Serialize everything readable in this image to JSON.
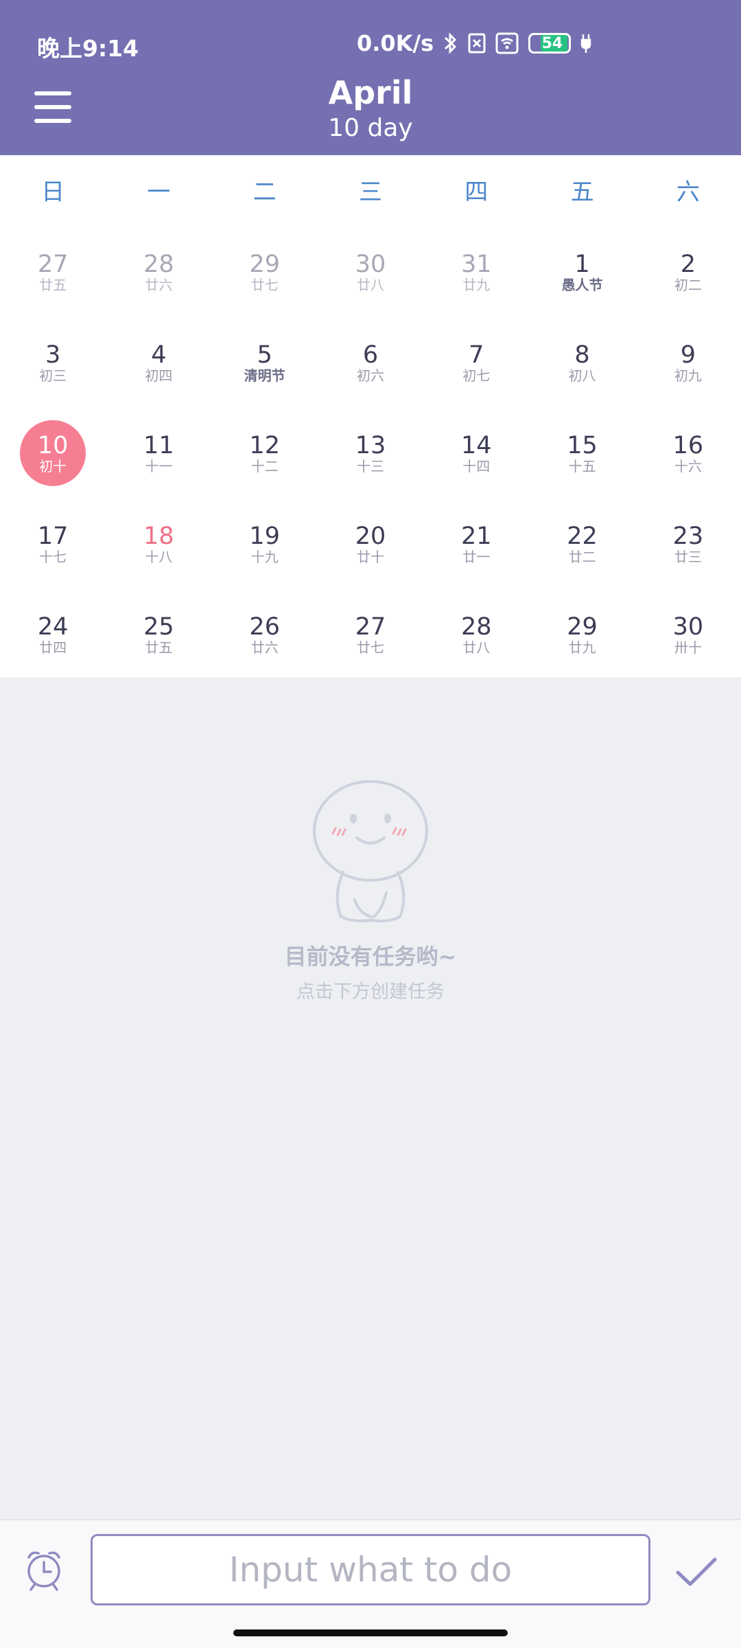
{
  "status_bar": {
    "time": "晚上9:14",
    "network_speed": "0.0K/s",
    "battery_level": "54",
    "icons": [
      "bluetooth-icon",
      "sim-off-icon",
      "wifi-icon",
      "battery-icon",
      "charging-icon"
    ]
  },
  "header": {
    "month": "April",
    "day_label": "10 day",
    "menu_icon": "menu-icon"
  },
  "colors": {
    "header_bg": "#7570b1",
    "weekday_text": "#4a86c9",
    "today_circle": "#f67e92",
    "holiday_text": "#f06f86",
    "page_bg": "#eeeff3"
  },
  "weekdays": [
    "日",
    "一",
    "二",
    "三",
    "四",
    "五",
    "六"
  ],
  "days": [
    {
      "num": "27",
      "lunar": "廿五"
    },
    {
      "num": "28",
      "lunar": "廿六"
    },
    {
      "num": "29",
      "lunar": "廿七"
    },
    {
      "num": "30",
      "lunar": "廿八"
    },
    {
      "num": "31",
      "lunar": "廿九"
    },
    {
      "num": "1",
      "lunar": "愚人节"
    },
    {
      "num": "2",
      "lunar": "初二"
    },
    {
      "num": "3",
      "lunar": "初三"
    },
    {
      "num": "4",
      "lunar": "初四"
    },
    {
      "num": "5",
      "lunar": "清明节"
    },
    {
      "num": "6",
      "lunar": "初六"
    },
    {
      "num": "7",
      "lunar": "初七"
    },
    {
      "num": "8",
      "lunar": "初八"
    },
    {
      "num": "9",
      "lunar": "初九"
    },
    {
      "num": "10",
      "lunar": "初十"
    },
    {
      "num": "11",
      "lunar": "十一"
    },
    {
      "num": "12",
      "lunar": "十二"
    },
    {
      "num": "13",
      "lunar": "十三"
    },
    {
      "num": "14",
      "lunar": "十四"
    },
    {
      "num": "15",
      "lunar": "十五"
    },
    {
      "num": "16",
      "lunar": "十六"
    },
    {
      "num": "17",
      "lunar": "十七"
    },
    {
      "num": "18",
      "lunar": "十八"
    },
    {
      "num": "19",
      "lunar": "十九"
    },
    {
      "num": "20",
      "lunar": "廿十"
    },
    {
      "num": "21",
      "lunar": "廿一"
    },
    {
      "num": "22",
      "lunar": "廿二"
    },
    {
      "num": "23",
      "lunar": "廿三"
    },
    {
      "num": "24",
      "lunar": "廿四"
    },
    {
      "num": "25",
      "lunar": "廿五"
    },
    {
      "num": "26",
      "lunar": "廿六"
    },
    {
      "num": "27",
      "lunar": "廿七"
    },
    {
      "num": "28",
      "lunar": "廿八"
    },
    {
      "num": "29",
      "lunar": "廿九"
    },
    {
      "num": "30",
      "lunar": "卅十"
    }
  ],
  "empty_state": {
    "title": "目前没有任务哟~",
    "subtitle": "点击下方创建任务",
    "illustration_icon": "ghost-mascot-icon"
  },
  "bottom_bar": {
    "input_placeholder": "Input what to do",
    "input_value": "",
    "alarm_icon": "alarm-clock-icon",
    "confirm_icon": "check-icon"
  }
}
